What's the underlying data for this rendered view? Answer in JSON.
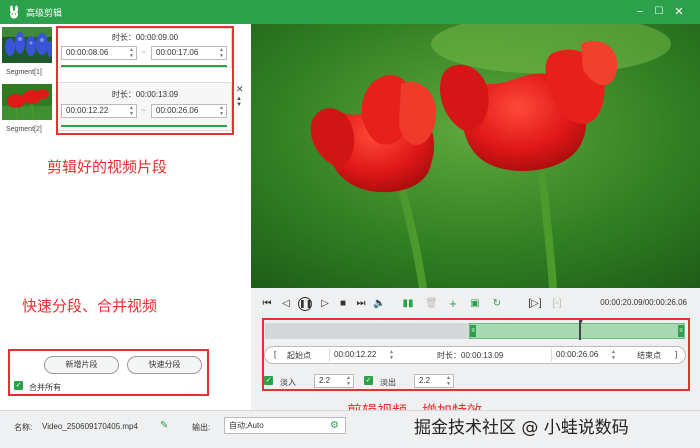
{
  "window": {
    "title": "高级剪辑",
    "minimize_glyph": "−",
    "maximize_glyph": "☐",
    "close_glyph": "✕",
    "logo_icon": "bunny-logo-icon"
  },
  "segments": [
    {
      "label": "Segment[1]",
      "duration": "时长：00:00:09.00",
      "start": "00:00:08.06",
      "end": "00:00:17.06",
      "thumb": "blue-flowers",
      "progress": 1.0
    },
    {
      "label": "Segment[2]",
      "duration": "时长：00:00:13.09",
      "start": "00:00:12.22",
      "end": "00:00:26.06",
      "thumb": "red-tulips",
      "progress": 1.0
    }
  ],
  "annotations": {
    "segments_note": "剪辑好的视频片段",
    "split_note": "快速分段、合并视频",
    "effects_note": "剪辑视频，增加特效"
  },
  "buttons": {
    "add_segment": "新增片段",
    "quick_split": "快速分段",
    "merge_all": "合并所有"
  },
  "player": {
    "timecode": "00:00:20.09/00:00:26.06"
  },
  "editor": {
    "start_label": "起始点",
    "start_value": "00:00:12.22",
    "duration_label": "时长：00:00:13.09",
    "end_value": "00:00:26.06",
    "end_label": "结束点",
    "fade_in_label": "淡入",
    "fade_in_value": "2.2",
    "fade_out_label": "淡出",
    "fade_out_value": "2.2",
    "selection_start": 0.486,
    "selection_end": 1.0,
    "playhead": 0.751
  },
  "footer": {
    "name_label": "名称:",
    "file_name": "Video_250609170405.mp4",
    "output_label": "输出:",
    "output_value": "自动;Auto"
  },
  "watermark": "掘金技术社区 @ 小蛙说数码",
  "colors": {
    "accent": "#2ca04b",
    "annotation_red": "#e5312f",
    "tulip_red": "#e01818"
  }
}
